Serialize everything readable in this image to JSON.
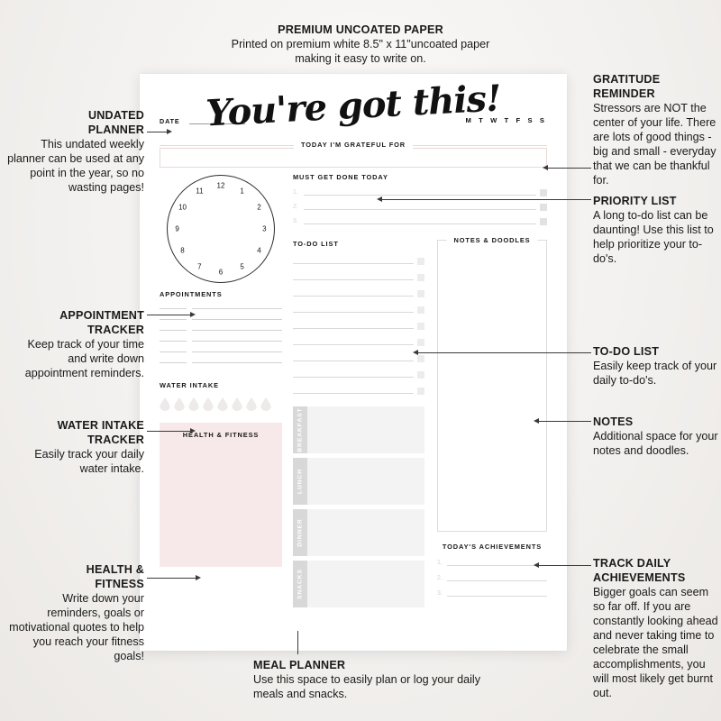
{
  "top_note": {
    "heading": "PREMIUM UNCOATED PAPER",
    "line1": "Printed on premium white 8.5\" x 11\"uncoated paper",
    "line2": "making it easy to write on."
  },
  "annotations": {
    "undated_planner": {
      "heading1": "UNDATED",
      "heading2": "PLANNER",
      "body": "This undated weekly planner can be used at any point in the year, so no wasting pages!"
    },
    "appointment_tracker": {
      "heading1": "APPOINTMENT",
      "heading2": "TRACKER",
      "body": "Keep track of your time and write down appointment reminders."
    },
    "water_intake_tracker": {
      "heading1": "WATER INTAKE",
      "heading2": "TRACKER",
      "body": "Easily track your daily water intake."
    },
    "health_fitness": {
      "heading1": "HEALTH &",
      "heading2": "FITNESS",
      "body": "Write down your reminders, goals or motivational quotes to help you reach your fitness goals!"
    },
    "meal_planner": {
      "heading": "MEAL PLANNER",
      "body": "Use this space to easily plan or log your daily meals and snacks."
    },
    "gratitude_reminder": {
      "heading1": "GRATITUDE",
      "heading2": "REMINDER",
      "body": "Stressors are NOT the center of your life. There are lots of good things - big and small - everyday that we can be thankful for."
    },
    "priority_list": {
      "heading": "PRIORITY LIST",
      "body": "A long to-do list can be daunting! Use this list to help prioritize your to-do's."
    },
    "todo_list": {
      "heading": "TO-DO LIST",
      "body": "Easily keep track of your daily to-do's."
    },
    "notes": {
      "heading": "NOTES",
      "body": "Additional space for your notes and doodles."
    },
    "track_daily_achievements": {
      "heading1": "TRACK DAILY",
      "heading2": "ACHIEVEMENTS",
      "body": "Bigger goals can seem so far off. If you are constantly looking ahead and never taking time to celebrate the small accomplishments, you will most likely get burnt out."
    }
  },
  "planner": {
    "date_label": "DATE",
    "script_title": "You're got this!",
    "days_of_week": "M T W T F S S",
    "grateful_title": "TODAY I'M GRATEFUL FOR",
    "clock_numbers": [
      "12",
      "1",
      "2",
      "3",
      "4",
      "5",
      "6",
      "7",
      "8",
      "9",
      "10",
      "11"
    ],
    "appointments_title": "APPOINTMENTS",
    "appointment_rows": 6,
    "water_title": "WATER INTAKE",
    "water_drops": 8,
    "health_title": "HEALTH & FITNESS",
    "must_get_done_title": "MUST GET DONE TODAY",
    "must_get_done_items": [
      "1.",
      "2.",
      "3."
    ],
    "todo_title": "TO-DO LIST",
    "todo_rows": 9,
    "notes_title": "NOTES & DOODLES",
    "meals": [
      "BREAKFAST",
      "LUNCH",
      "DINNER",
      "SNACKS"
    ],
    "achievements_title": "TODAY'S ACHIEVEMENTS",
    "achievement_items": [
      "1.",
      "2.",
      "3."
    ]
  },
  "colors": {
    "sheet": "#ffffff",
    "backdrop": "#f3f1ef",
    "health_box": "#f7e9e9",
    "grateful_border": "#e8d9d6",
    "meal_tab": "#d8d8d8",
    "meal_body": "#f3f3f3",
    "rule": "#d9d9d9",
    "text": "#1a1a1a"
  }
}
